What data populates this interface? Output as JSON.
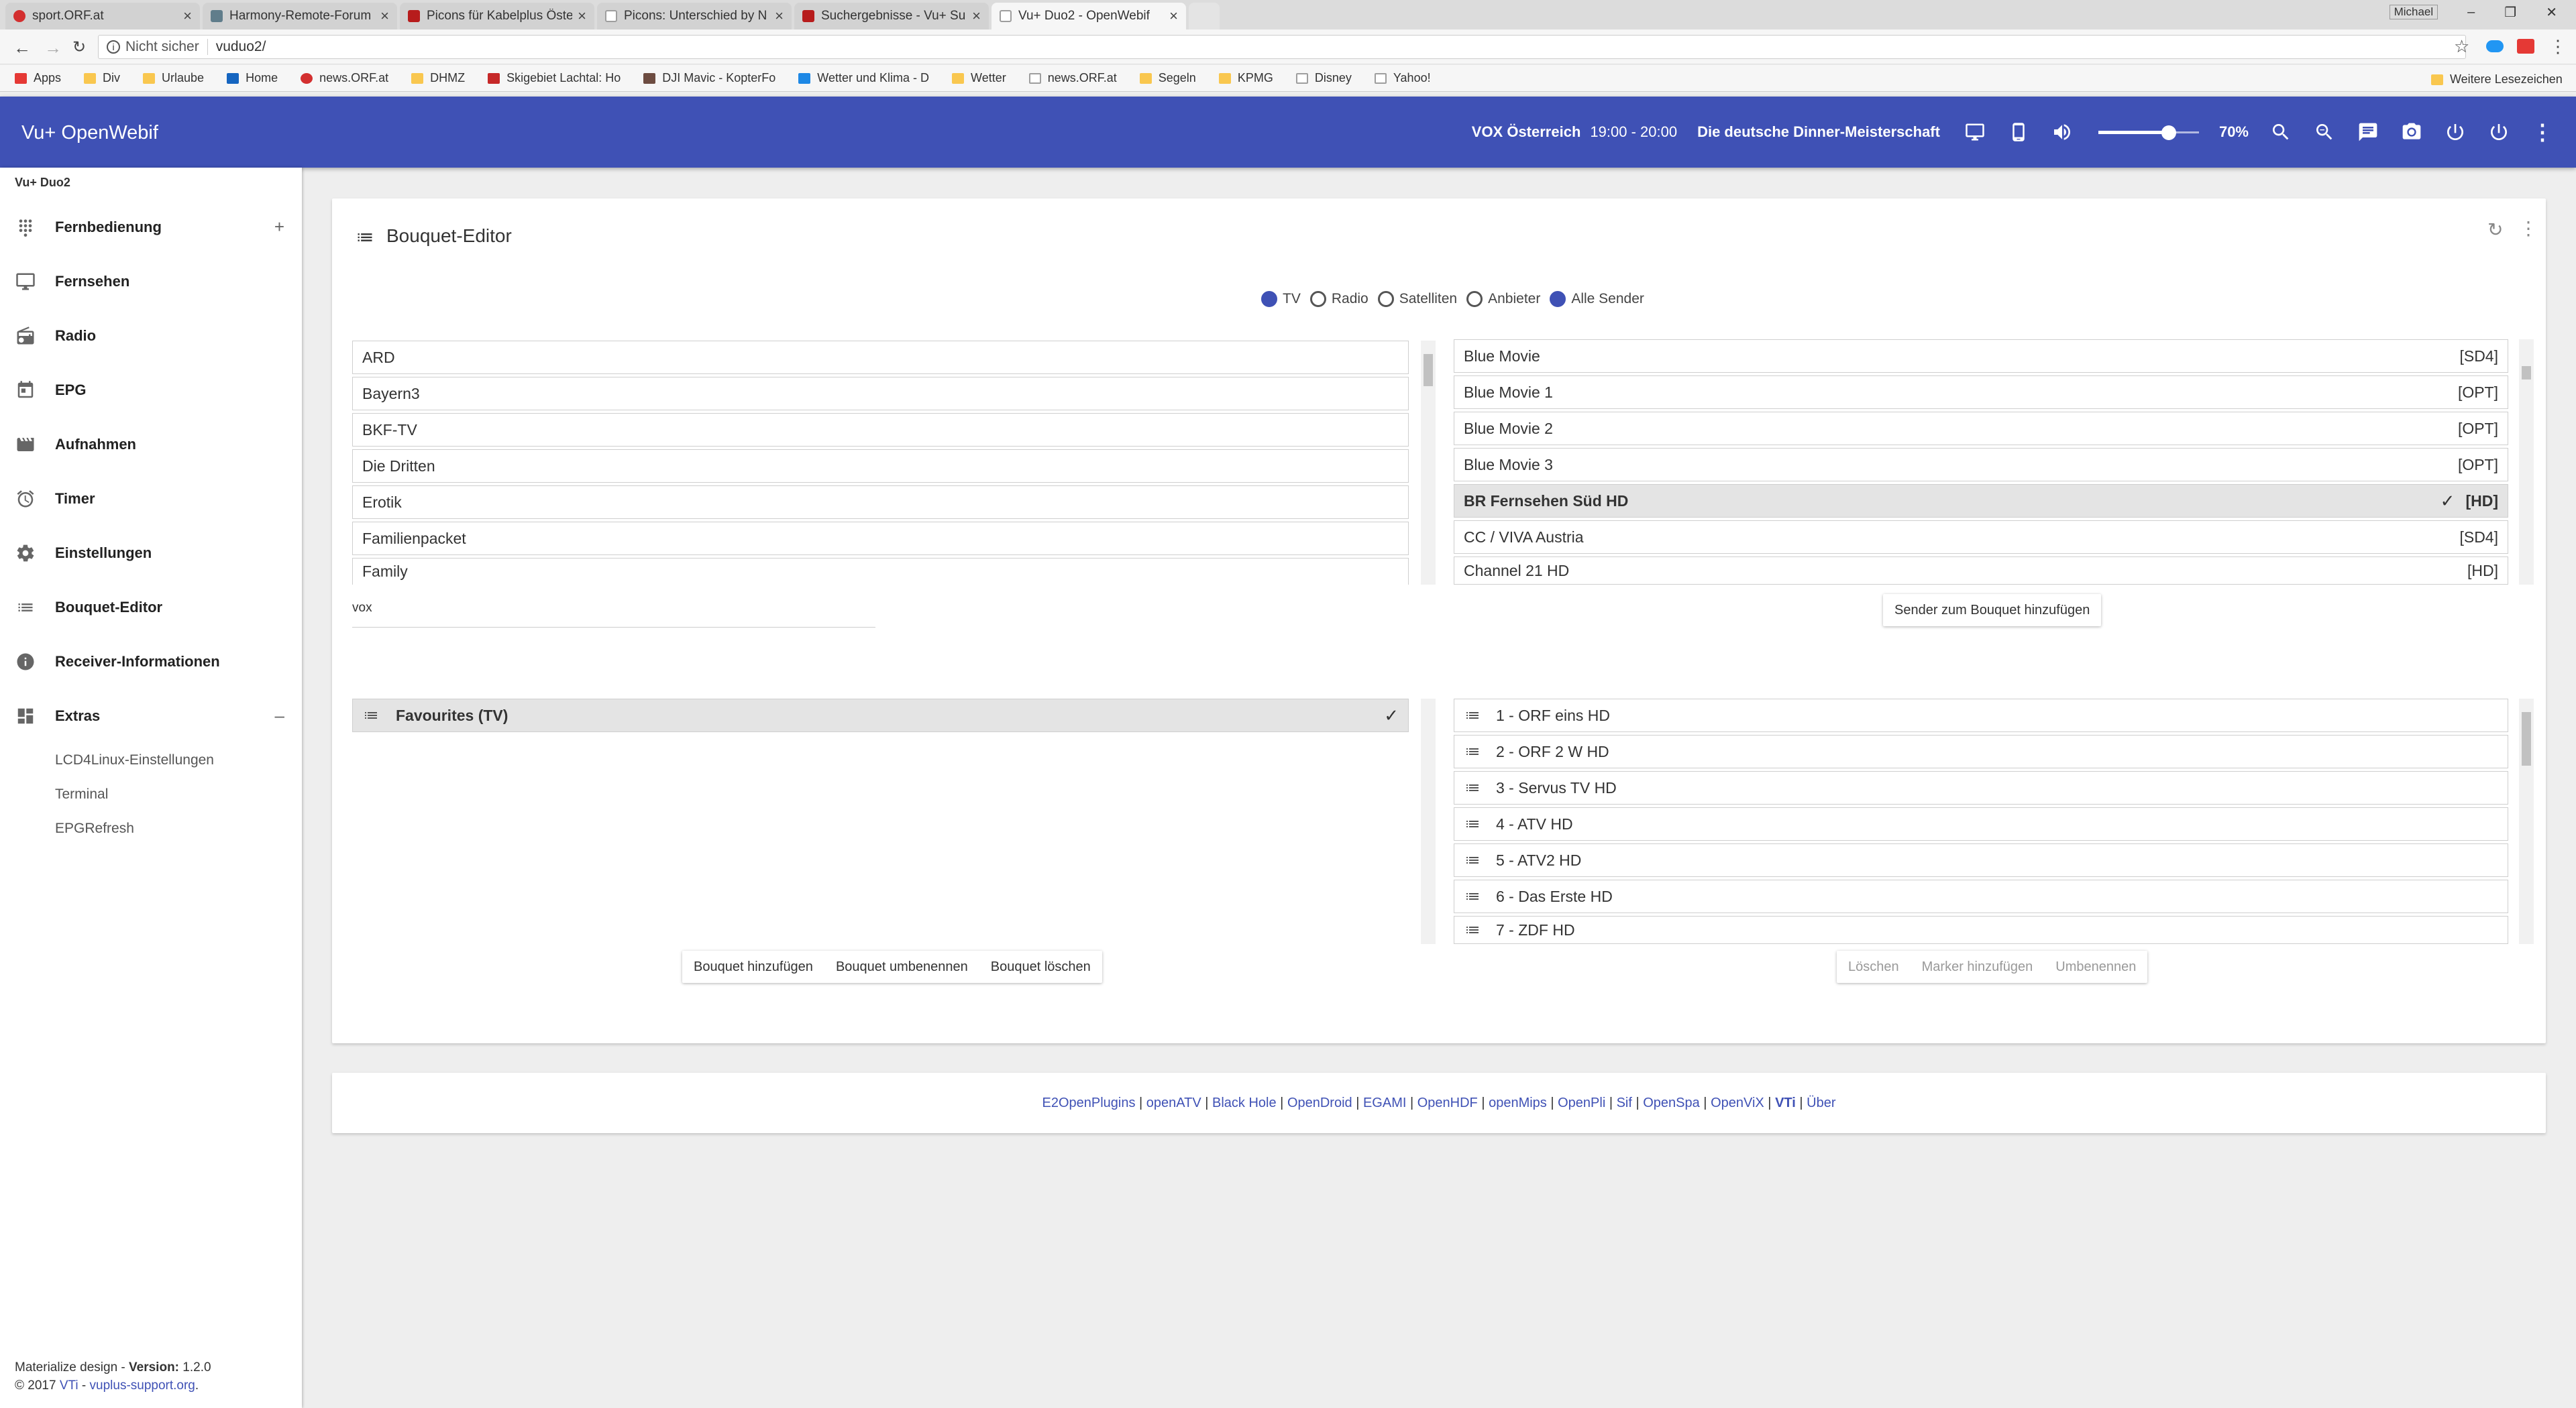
{
  "browser": {
    "tabs": [
      {
        "title": "sport.ORF.at",
        "color": "#d32f2f"
      },
      {
        "title": "Harmony-Remote-Forum",
        "color": "#607d8b"
      },
      {
        "title": "Picons für Kabelplus Öste",
        "color": "#b71c1c"
      },
      {
        "title": "Picons: Unterschied by N",
        "color": "#9e9e9e"
      },
      {
        "title": "Suchergebnisse - Vu+ Su",
        "color": "#b71c1c"
      },
      {
        "title": "Vu+ Duo2 - OpenWebif",
        "color": "#9e9e9e"
      }
    ],
    "profile": "Michael",
    "security_label": "Nicht sicher",
    "url": "vuduo2/",
    "bookmarks": [
      {
        "label": "Apps",
        "color": "#e53935"
      },
      {
        "label": "Div",
        "color": "#f9c74f"
      },
      {
        "label": "Urlaube",
        "color": "#f9c74f"
      },
      {
        "label": "Home",
        "color": "#1565c0"
      },
      {
        "label": "news.ORF.at",
        "color": "#d32f2f"
      },
      {
        "label": "DHMZ",
        "color": "#f9c74f"
      },
      {
        "label": "Skigebiet Lachtal: Ho",
        "color": "#c62828"
      },
      {
        "label": "DJI Mavic - KopterFo",
        "color": "#6d4c41"
      },
      {
        "label": "Wetter und Klima - D",
        "color": "#1e88e5"
      },
      {
        "label": "Wetter",
        "color": "#f9c74f"
      },
      {
        "label": "news.ORF.at",
        "color": "#9e9e9e"
      },
      {
        "label": "Segeln",
        "color": "#f9c74f"
      },
      {
        "label": "KPMG",
        "color": "#f9c74f"
      },
      {
        "label": "Disney",
        "color": "#9e9e9e"
      },
      {
        "label": "Yahoo!",
        "color": "#9e9e9e"
      }
    ],
    "other_bookmarks": "Weitere Lesezeichen"
  },
  "header": {
    "brand": "Vu+ OpenWebif",
    "channel": "VOX Österreich",
    "time": "19:00 - 20:00",
    "program": "Die deutsche Dinner-Meisterschaft",
    "volume_percent": 70,
    "volume_label": "70%",
    "color": "#3f51b5"
  },
  "sidebar": {
    "device": "Vu+ Duo2",
    "items": [
      {
        "label": "Fernbedienung",
        "icon": "remote-icon",
        "toggle": "+"
      },
      {
        "label": "Fernsehen",
        "icon": "tv-icon",
        "toggle": ""
      },
      {
        "label": "Radio",
        "icon": "radio-icon",
        "toggle": ""
      },
      {
        "label": "EPG",
        "icon": "calendar-icon",
        "toggle": ""
      },
      {
        "label": "Aufnahmen",
        "icon": "movie-icon",
        "toggle": ""
      },
      {
        "label": "Timer",
        "icon": "alarm-icon",
        "toggle": ""
      },
      {
        "label": "Einstellungen",
        "icon": "gear-icon",
        "toggle": ""
      },
      {
        "label": "Bouquet-Editor",
        "icon": "list-icon",
        "toggle": ""
      },
      {
        "label": "Receiver-Informationen",
        "icon": "info-icon",
        "toggle": ""
      },
      {
        "label": "Extras",
        "icon": "dashboard-icon",
        "toggle": "–"
      }
    ],
    "subitems": [
      "LCD4Linux-Einstellungen",
      "Terminal",
      "EPGRefresh"
    ],
    "footer_design": "Materialize design - ",
    "footer_version_label": "Version:",
    "footer_version": " 1.2.0",
    "footer_copy": "© 2017 ",
    "footer_vti": "VTi",
    "footer_sep": " - ",
    "footer_site": "vuplus-support.org",
    "footer_dot": "."
  },
  "editor": {
    "title": "Bouquet-Editor",
    "radios": [
      {
        "label": "TV",
        "checked": true
      },
      {
        "label": "Radio",
        "checked": false
      },
      {
        "label": "Satelliten",
        "checked": false
      },
      {
        "label": "Anbieter",
        "checked": false
      },
      {
        "label": "Alle Sender",
        "checked": true
      }
    ],
    "providers": [
      "ARD",
      "Bayern3",
      "BKF-TV",
      "Die Dritten",
      "Erotik",
      "Familienpacket",
      "Family"
    ],
    "search_value": "vox",
    "channels": [
      {
        "name": "Blue Movie",
        "tag": "[SD4]",
        "selected": false
      },
      {
        "name": "Blue Movie 1",
        "tag": "[OPT]",
        "selected": false
      },
      {
        "name": "Blue Movie 2",
        "tag": "[OPT]",
        "selected": false
      },
      {
        "name": "Blue Movie 3",
        "tag": "[OPT]",
        "selected": false
      },
      {
        "name": "BR Fernsehen Süd HD",
        "tag": "[HD]",
        "selected": true
      },
      {
        "name": "CC / VIVA Austria",
        "tag": "[SD4]",
        "selected": false
      },
      {
        "name": "Channel 21 HD",
        "tag": "[HD]",
        "selected": false
      }
    ],
    "add_channel_button": "Sender zum Bouquet hinzufügen",
    "bouquets": [
      "Favourites (TV)"
    ],
    "bouquet_channels": [
      "1 - ORF eins HD",
      "2 - ORF 2 W HD",
      "3 - Servus TV HD",
      "4 - ATV HD",
      "5 - ATV2 HD",
      "6 - Das Erste HD",
      "7 - ZDF HD"
    ],
    "bouquet_buttons": [
      "Bouquet hinzufügen",
      "Bouquet umbenennen",
      "Bouquet löschen"
    ],
    "channel_buttons": [
      "Löschen",
      "Marker hinzufügen",
      "Umbenennen"
    ]
  },
  "footer_links": {
    "links": [
      "E2OpenPlugins",
      "openATV",
      "Black Hole",
      "OpenDroid",
      "EGAMI",
      "OpenHDF",
      "openMips",
      "OpenPli",
      "Sif",
      "OpenSpa",
      "OpenViX",
      "VTi",
      "Über"
    ],
    "separator": " | "
  }
}
